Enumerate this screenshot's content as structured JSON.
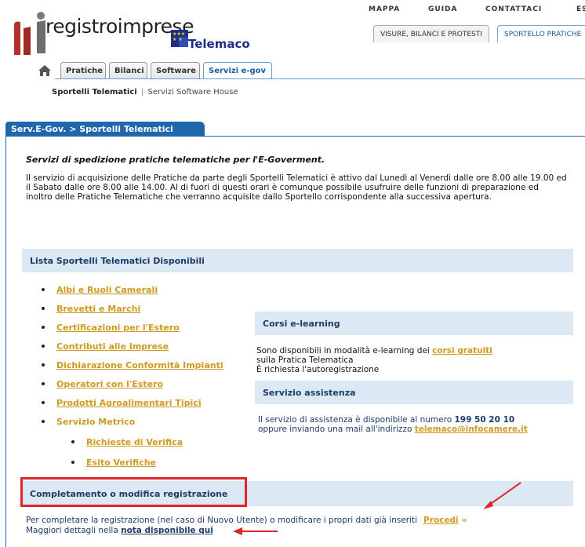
{
  "topnav": {
    "mappa": "MAPPA",
    "guida": "GUIDA",
    "contattaci": "CONTATTACI",
    "esci": "ESCI"
  },
  "brand": {
    "name": "registroimprese",
    "telemaco": "Telemaco"
  },
  "toptabs": {
    "visure": "VISURE, BILANCI E PROTESTI",
    "sportello": "SPORTELLO PRATICHE"
  },
  "tabs": [
    "Pratiche",
    "Bilanci",
    "Software",
    "Servizi e-gov"
  ],
  "subnav": {
    "current": "Sportelli Telematici",
    "sep": "|",
    "other": "Servizi Software House"
  },
  "section_title": "Serv.E-Gov. > Sportelli Telematici",
  "intro": {
    "title": "Servizi di spedizione pratiche telematiche per l'E-Goverment.",
    "text": "Il servizio di acquisizione delle Pratiche da parte degli Sportelli Telematici è attivo dal Lunedì al Venerdì dalle ore 8.00 alle 19.00 ed il Sabato dalle ore 8.00 alle 14.00. Al di fuori di questi orari è comunque possibile usufruire delle funzioni di preparazione ed inoltro delle Pratiche Telematiche che verranno acquisite dallo Sportello corrispondente alla successiva apertura."
  },
  "lista": {
    "title": "Lista Sportelli Telematici Disponibili",
    "items": [
      "Albi e Ruoli Camerali",
      "Brevetti e Marchi",
      "Certificazioni per l'Estero",
      "Contributi alle Imprese",
      "Dichiarazione Conformità Impianti",
      "Operatori con l'Estero",
      "Prodotti Agroalimentari Tipici",
      "Servizio Metrico"
    ],
    "subitems": [
      "Richieste di Verifica",
      "Esito Verifiche"
    ]
  },
  "elearning": {
    "title": "Corsi e-learning",
    "line1_pre": "Sono disponibili in modalità e-learning dei ",
    "line1_link": "corsi gratuiti",
    "line2": "sulla Pratica Telematica",
    "line3": "È richiesta l'autoregistrazione"
  },
  "assistenza": {
    "title": "Servizio assistenza",
    "line1_pre": "Il servizio di assistenza è disponibile al numero ",
    "number": "199 50 20 10",
    "line2_pre": "oppure inviando una mail all'indirizzo ",
    "email": "telemaco@infocamere.it"
  },
  "completamento": {
    "title": "Completamento o modifica registrazione",
    "line1": "Per completare la registrazione (nel caso di Nuovo Utente) o modificare i propri dati già inseriti",
    "procedi": "Procedi",
    "raquo": "»",
    "line2_pre": "Maggiori dettagli nella ",
    "nota": "nota disponibile qui"
  },
  "colors": {
    "accent_blue": "#1f66ad",
    "link_gold": "#d09a21",
    "bar_bg": "#dde8f5",
    "highlight_red": "#e0262a"
  }
}
